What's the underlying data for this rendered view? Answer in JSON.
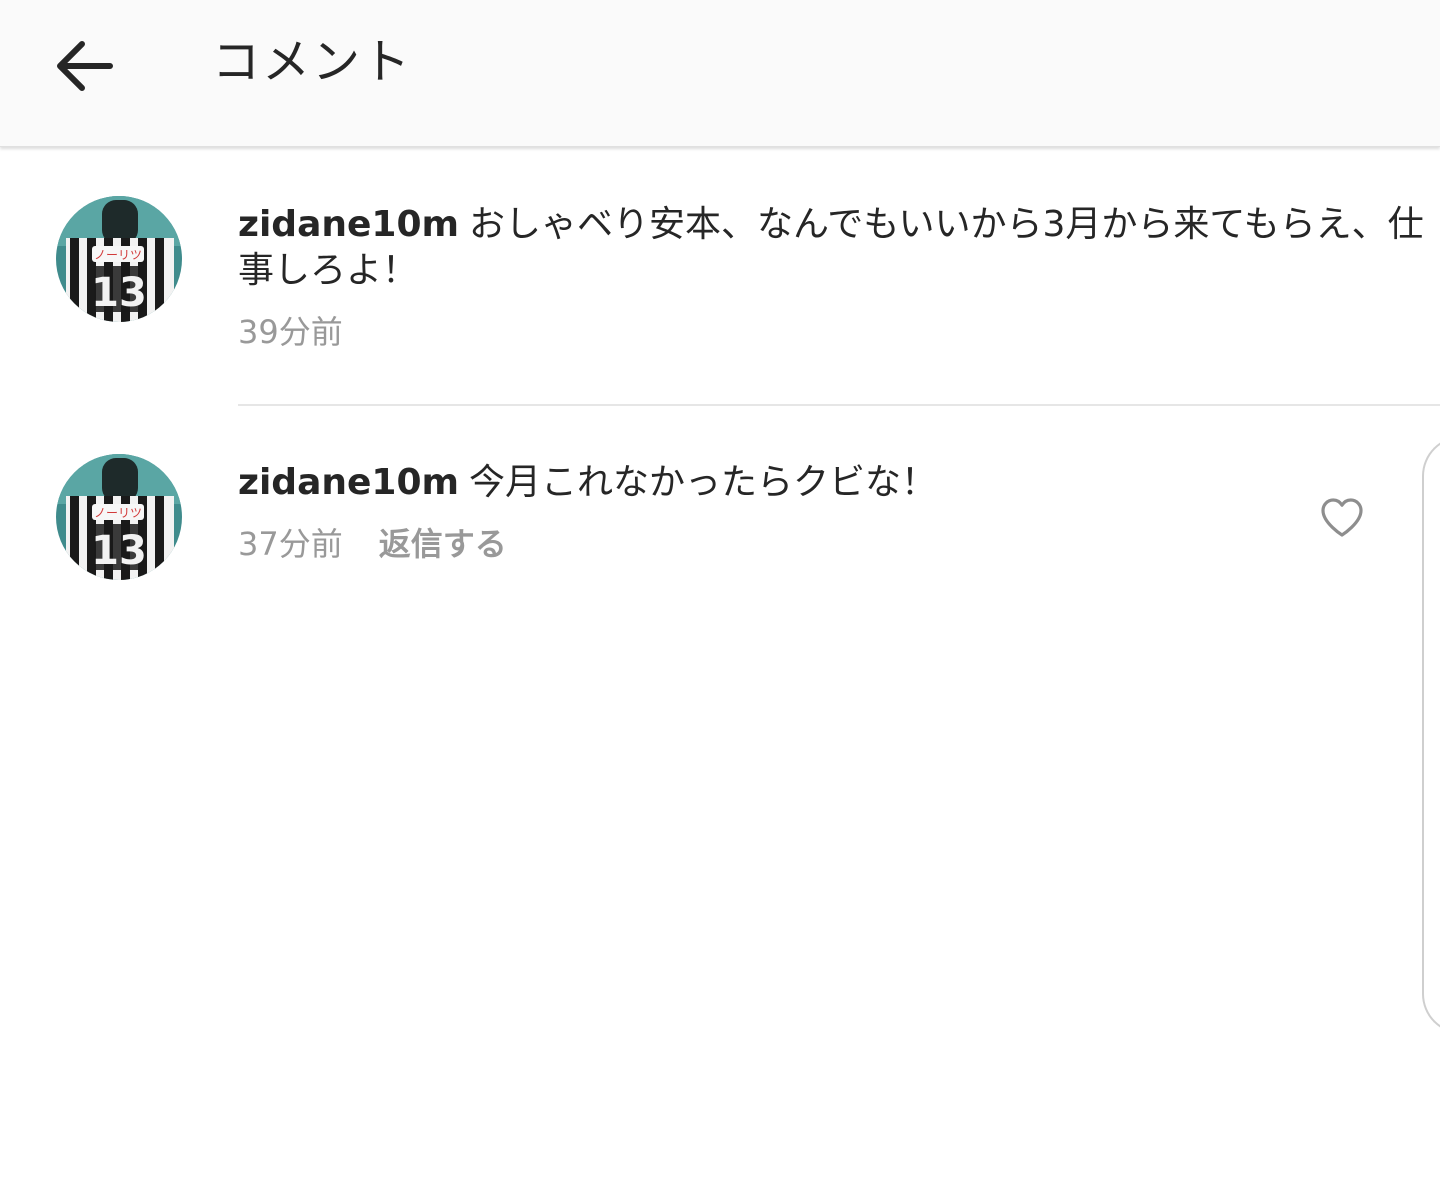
{
  "header": {
    "title": "コメント",
    "back_icon": "arrow-left-icon"
  },
  "comments": [
    {
      "username": "zidane10m",
      "text": "おしゃベり安本、なんでもいいから3月から来てもらえ、仕事しろよ！",
      "time": "39分前"
    },
    {
      "username": "zidane10m",
      "text": "今月これなかったらクビな！",
      "time": "37分前",
      "reply_label": "返信する",
      "like_icon": "heart-outline-icon"
    }
  ],
  "avatar": {
    "jersey_number": "13",
    "jersey_name": "ノーリツ"
  },
  "colors": {
    "text": "#262626",
    "muted": "#999999",
    "header_bg": "#fafafa",
    "divider": "#e6e6e6"
  }
}
